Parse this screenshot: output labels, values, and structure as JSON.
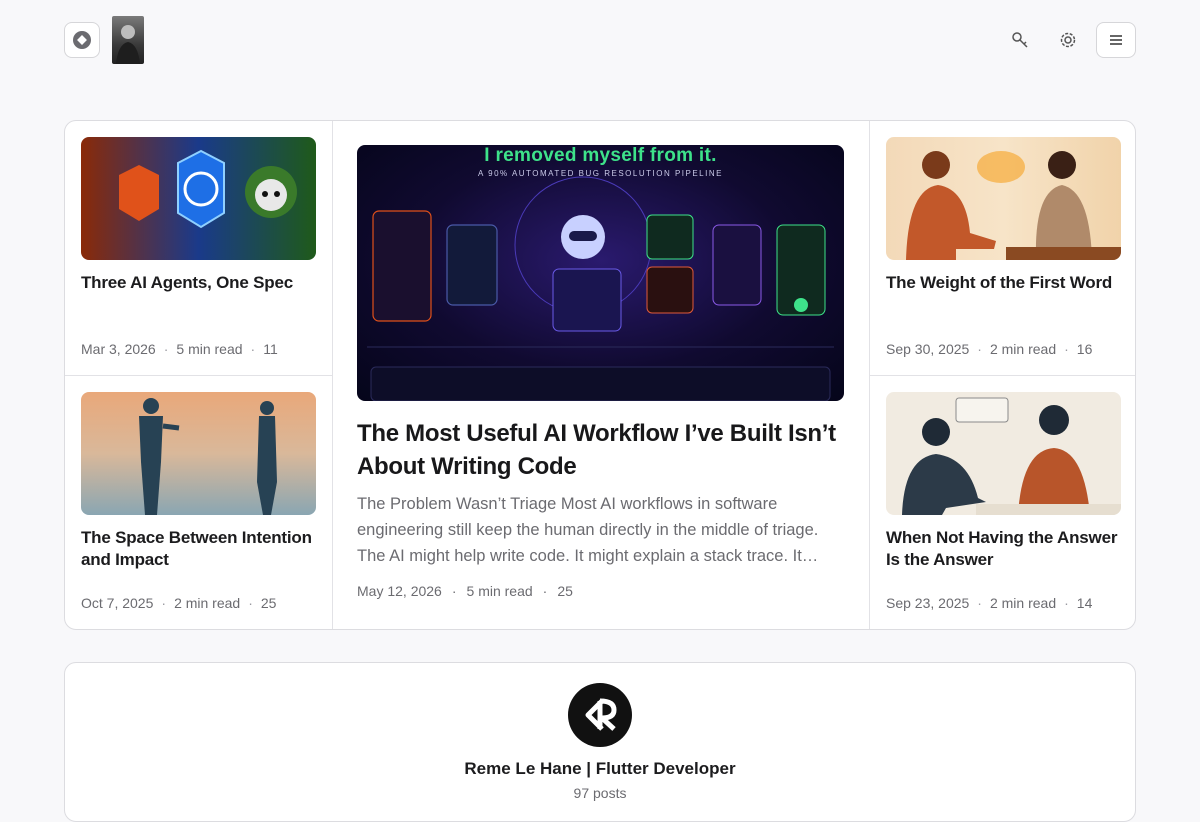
{
  "header": {
    "logo_icon": "diamond-icon",
    "actions": [
      "key-icon",
      "gear-icon",
      "menu-icon"
    ]
  },
  "posts": {
    "left_top": {
      "title": "Three AI Agents, One Spec",
      "date": "Mar 3, 2026",
      "read": "5 min read",
      "count": "11"
    },
    "left_bottom": {
      "title": "The Space Between Intention and Impact",
      "date": "Oct 7, 2025",
      "read": "2 min read",
      "count": "25"
    },
    "featured": {
      "image_headline": "I removed myself from it.",
      "image_subheadline": "A 90% AUTOMATED BUG RESOLUTION PIPELINE",
      "title": "The Most Useful AI Workflow I’ve Built Isn’t About Writing Code",
      "excerpt": "The Problem Wasn’t Triage Most AI workflows in software engineering still keep the human directly in the middle of triage. The AI might help write code. It might explain a stack trace. It…",
      "date": "May 12, 2026",
      "read": "5 min read",
      "count": "25"
    },
    "right_top": {
      "title": "The Weight of the First Word",
      "date": "Sep 30, 2025",
      "read": "2 min read",
      "count": "16"
    },
    "right_bottom": {
      "title": "When Not Having the Answer Is the Answer",
      "date": "Sep 23, 2025",
      "read": "2 min read",
      "count": "14"
    }
  },
  "author": {
    "name": "Reme Le Hane | Flutter Developer",
    "posts": "97 posts"
  },
  "colors": {
    "accent_green": "#3ee28a",
    "border": "#dcdce0"
  }
}
